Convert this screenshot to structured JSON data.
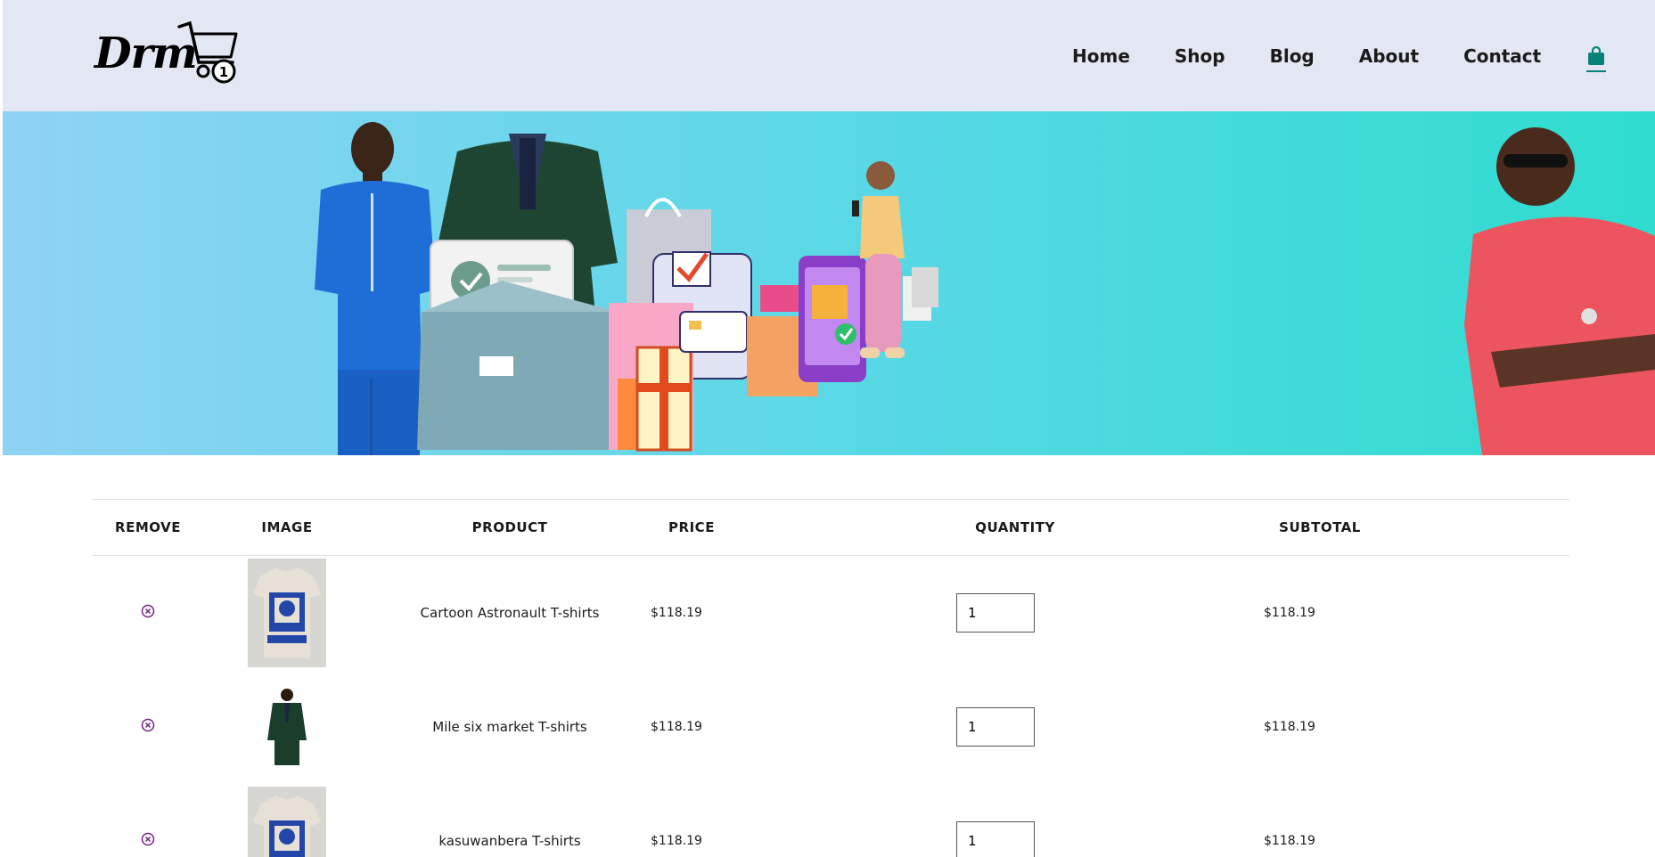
{
  "header": {
    "logo_text": "Drm",
    "cart_badge": "1",
    "nav": [
      "Home",
      "Shop",
      "Blog",
      "About",
      "Contact"
    ]
  },
  "table": {
    "headers": [
      "REMOVE",
      "IMAGE",
      "PRODUCT",
      "PRICE",
      "QUANTITY",
      "SUBTOTAL"
    ],
    "rows": [
      {
        "product": "Cartoon Astronault T-shirts",
        "price": "$118.19",
        "quantity": "1",
        "subtotal": "$118.19",
        "image": "tshirt-original-icon"
      },
      {
        "product": "Mile six market T-shirts",
        "price": "$118.19",
        "quantity": "1",
        "subtotal": "$118.19",
        "image": "green-suit-icon"
      },
      {
        "product": "kasuwanbera T-shirts",
        "price": "$118.19",
        "quantity": "1",
        "subtotal": "$118.19",
        "image": "tshirt-original-icon"
      }
    ]
  },
  "colors": {
    "header_bg": "#e3e6f3",
    "accent": "#088178",
    "remove_icon": "#7a1f8a",
    "hero_gradient_start": "#8fd3f4",
    "hero_gradient_end": "#2fdccf"
  }
}
